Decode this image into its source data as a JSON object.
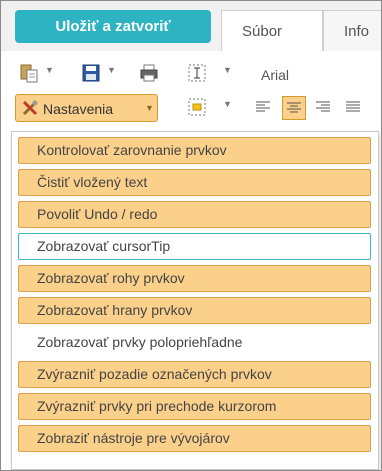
{
  "header": {
    "save_close_label": "Uložiť a zatvoriť",
    "tabs": [
      {
        "label": "Súbor"
      },
      {
        "label": "Info"
      }
    ]
  },
  "toolbar": {
    "font_name": "Arial",
    "settings_label": "Nastavenia"
  },
  "menu": {
    "items": [
      {
        "label": "Kontrolovať zarovnanie prvkov",
        "checked": true
      },
      {
        "label": "Čistiť vložený text",
        "checked": true
      },
      {
        "label": "Povoliť Undo / redo",
        "checked": true
      },
      {
        "label": "Zobrazovať cursorTip",
        "checked": false
      },
      {
        "label": "Zobrazovať rohy prvkov",
        "checked": true
      },
      {
        "label": "Zobrazovať hrany prvkov",
        "checked": true
      },
      {
        "label": "Zobrazovať prvky polopriehľadne",
        "checked": false
      },
      {
        "label": "Zvýrazniť pozadie označených prvkov",
        "checked": true
      },
      {
        "label": "Zvýrazniť prvky pri prechode kurzorom",
        "checked": true
      },
      {
        "label": "Zobraziť nástroje pre vývojárov",
        "checked": true
      }
    ]
  },
  "colors": {
    "accent": "#2db3c2",
    "selected_fill": "#fbd08a",
    "selected_border": "#d9a24a",
    "hover_border": "#3fb6c6"
  }
}
